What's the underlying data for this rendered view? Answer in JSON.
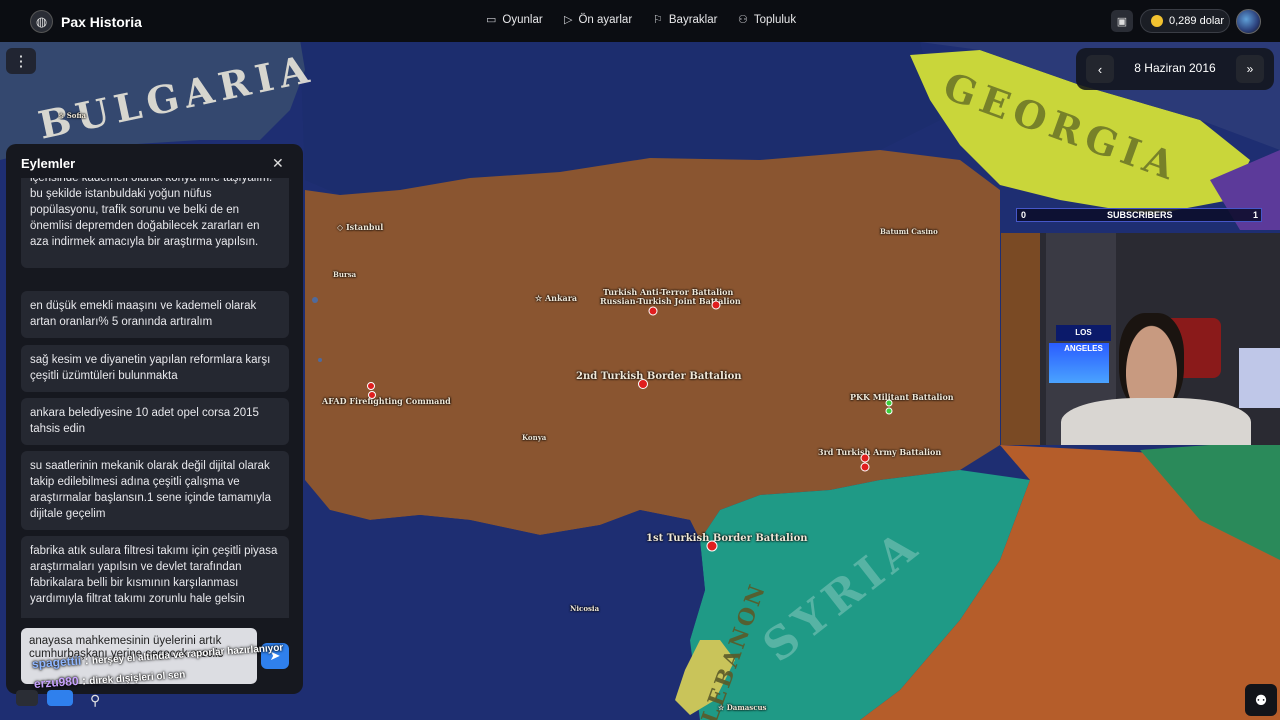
{
  "app": {
    "name": "Pax Historia",
    "nav": [
      {
        "label": "Oyunlar",
        "icon": "gamepad-icon"
      },
      {
        "label": "Ön ayarlar",
        "icon": "play-icon"
      },
      {
        "label": "Bayraklar",
        "icon": "flag-icon"
      },
      {
        "label": "Topluluk",
        "icon": "users-icon"
      }
    ],
    "balance": "0,289 dolar",
    "colors": {
      "topbar": "#0b0d12",
      "accent": "#2f80ed",
      "turkey": "#8a5530",
      "georgia": "#c9d63a",
      "syria": "#1f9a86",
      "sea": "#1e2e72"
    }
  },
  "date": {
    "label": "8 Haziran 2016",
    "prev_icon": "chevron-left-icon",
    "next_icon": "fast-forward-icon"
  },
  "map": {
    "countries": [
      "BULGARIA",
      "GEORGIA",
      "SYRIA",
      "LEBANON"
    ],
    "cities": [
      "Sofia",
      "Istanbul",
      "Bursa",
      "Ankara",
      "Konya",
      "Nicosia",
      "Damascus",
      "Batumi Casino"
    ],
    "units": [
      "Turkish Anti-Terror Battalion",
      "Russian-Turkish Joint Battalion",
      "2nd Turkish Border Battalion",
      "AFAD Firefighting Command",
      "PKK Militant Battalion",
      "3rd Turkish Army Battalion",
      "1st Turkish Border Battalion"
    ]
  },
  "panel": {
    "title": "Eylemler",
    "actions": [
      "içerisinde kademeli olarak konya iline taşıyalım. bu şekilde istanbuldaki yoğun nüfus popülasyonu, trafik sorunu ve belki de en önemlisi depremden doğabilecek zararları en aza indirmek amacıyla bir araştırma yapılsın.",
      "en düşük emekli maaşını ve kademeli olarak artan oranları% 5 oranında artıralım",
      "sağ kesim ve diyanetin yapılan reformlara karşı çeşitli üzümtüleri bulunmakta",
      "ankara belediyesine 10 adet opel corsa 2015 tahsis edin",
      "su saatlerinin mekanik olarak değil dijital olarak takip edilebilmesi adına çeşitli çalışma ve araştırmalar başlansın.1 sene içinde tamamıyla dijitale geçelim",
      "fabrika atık sulara filtresi takımı için çeşitli piyasa araştırmaları yapılsın ve devlet tarafından fabrikalara belli bir kısmının karşılanması yardımıyla filtrat takımı zorunlu hale gelsin"
    ],
    "input_value": "anayasa mahkemesinin üyelerini artık cumhurbaşkanı yerine seçecek meclis"
  },
  "chat": [
    {
      "user": "spagettii",
      "message": "herşey el altında ve raporlar hazırlanıyor",
      "color": "#8fb6ff"
    },
    {
      "user": "erzu980",
      "message": "direk dışişleri ol sen",
      "color": "#c8a2ff"
    }
  ],
  "overlay": {
    "subs_title": "SUBSCRIBERS",
    "subs_left": "0",
    "subs_right": "1",
    "cam_poster": "LOS ANGELES"
  }
}
